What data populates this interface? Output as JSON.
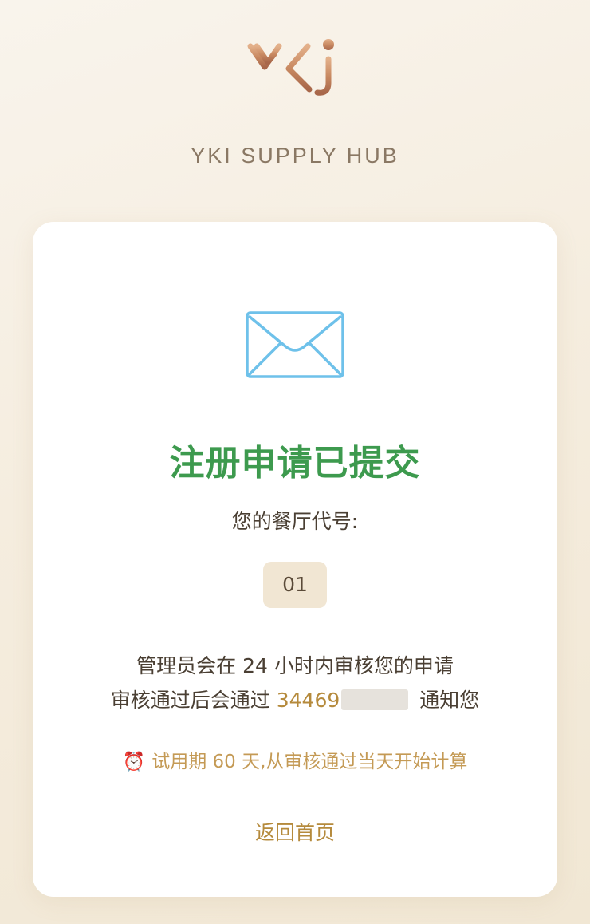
{
  "brand": {
    "logo_text": "YKi",
    "name": "YKI SUPPLY HUB"
  },
  "card": {
    "title": "注册申请已提交",
    "code_label": "您的餐厅代号:",
    "code_value": "01",
    "review_line": "管理员会在 24 小时内审核您的申请",
    "notify_prefix": "审核通过后会通过 ",
    "notify_phone": "34469",
    "notify_suffix": " 通知您",
    "trial_icon": "⏰",
    "trial_text": "试用期 60 天,从审核通过当天开始计算",
    "back_link": "返回首页"
  },
  "colors": {
    "title_green": "#3d9a4e",
    "accent_gold": "#b58a3c",
    "icon_blue": "#6ec1ea",
    "logo_copper": "#c98a62"
  },
  "icons": {
    "logo": "yki-logo",
    "mail": "envelope-icon",
    "alarm": "alarm-clock-icon"
  }
}
